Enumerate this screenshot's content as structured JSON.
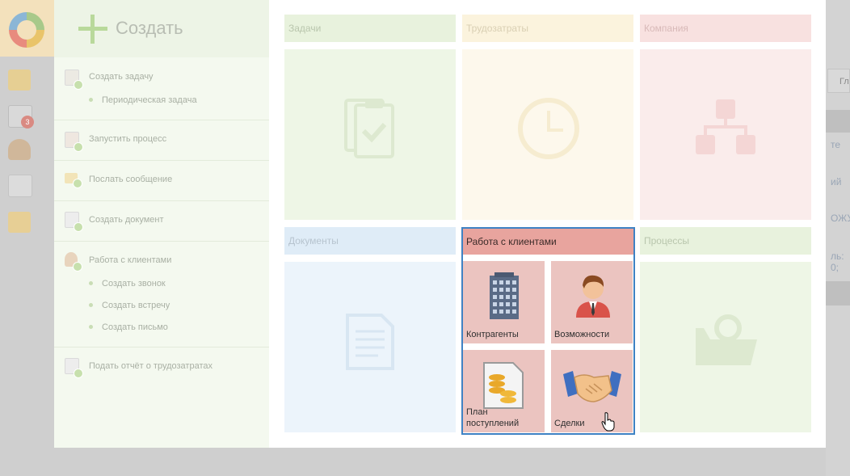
{
  "create_panel": {
    "title": "Создать",
    "items": [
      {
        "label": "Создать задачу",
        "subitems": [
          "Периодическая задача"
        ]
      },
      {
        "label": "Запустить процесс",
        "subitems": []
      },
      {
        "label": "Послать сообщение",
        "subitems": []
      },
      {
        "label": "Создать документ",
        "subitems": []
      },
      {
        "label": "Работа с клиентами",
        "subitems": [
          "Создать звонок",
          "Создать встречу",
          "Создать письмо"
        ]
      },
      {
        "label": "Подать отчёт о трудозатратах",
        "subitems": []
      }
    ]
  },
  "tiles": {
    "tasks": {
      "title": "Задачи",
      "icon": "clipboard-check-icon"
    },
    "labor": {
      "title": "Трудозатраты",
      "icon": "clock-icon"
    },
    "company": {
      "title": "Компания",
      "icon": "org-chart-icon"
    },
    "documents": {
      "title": "Документы",
      "icon": "document-icon"
    },
    "processes": {
      "title": "Процессы",
      "icon": "folder-chart-icon"
    },
    "clients": {
      "title": "Работа с клиентами",
      "items": [
        {
          "label": "Контрагенты",
          "icon": "building-icon"
        },
        {
          "label": "Возможности",
          "icon": "person-icon"
        },
        {
          "label": "План поступлений",
          "icon": "coins-document-icon"
        },
        {
          "label": "Сделки",
          "icon": "handshake-icon"
        }
      ]
    }
  },
  "background": {
    "badge": "3",
    "right_button": "Гл",
    "right_texts": [
      "те",
      "ий",
      "ОЖУ",
      "ль: 0;"
    ]
  },
  "colors": {
    "highlight_border": "#3f82c4",
    "clients_header": "#e8a49e",
    "clients_tile": "#ebc4c0"
  }
}
